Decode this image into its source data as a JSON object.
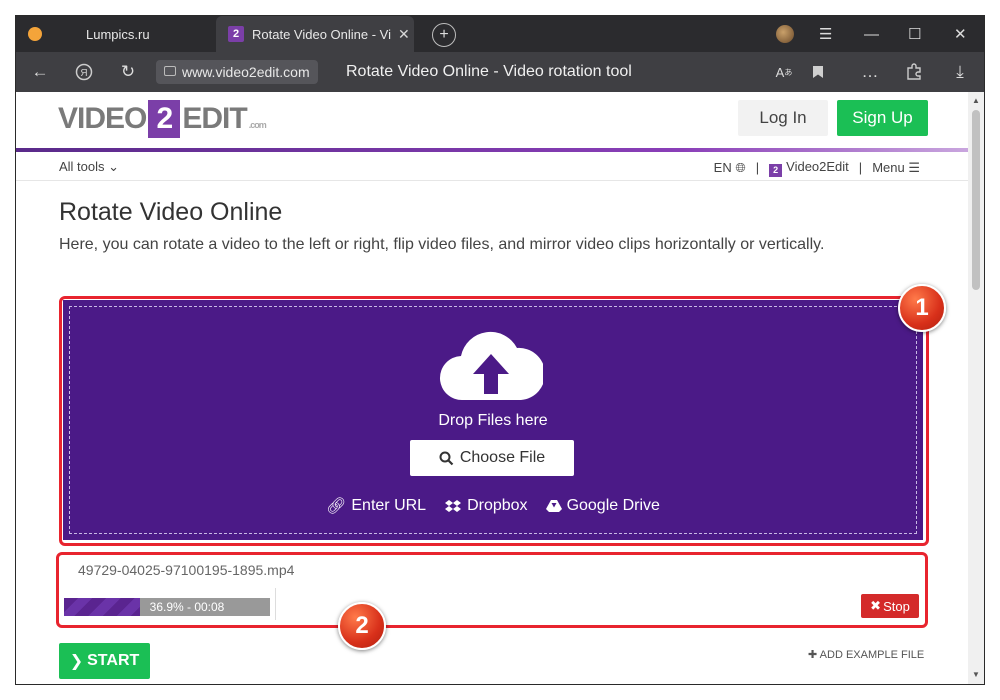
{
  "browser": {
    "tabs": [
      {
        "label": "Lumpics.ru"
      },
      {
        "label": "Rotate Video Online - Vi",
        "favicon_text": "2"
      }
    ],
    "url": "www.video2edit.com",
    "page_title": "Rotate Video Online - Video rotation tool"
  },
  "site": {
    "logo_video": "VIDEO",
    "logo_two": "2",
    "logo_edit": "EDIT",
    "logo_com": ".com",
    "login_label": "Log In",
    "signup_label": "Sign Up",
    "all_tools": "All tools",
    "lang": "EN",
    "brand_link": "Video2Edit",
    "brand_badge": "2",
    "menu": "Menu"
  },
  "main": {
    "title": "Rotate Video Online",
    "description": "Here, you can rotate a video to the left or right, flip video files, and mirror video clips horizontally or vertically."
  },
  "upload": {
    "drop_text": "Drop Files here",
    "choose_label": "Choose File",
    "enter_url": "Enter URL",
    "dropbox": "Dropbox",
    "google_drive": "Google Drive"
  },
  "file": {
    "name": "49729-04025-97100195-1895.mp4",
    "progress_text": "36.9% - 00:08",
    "progress_percent": 36.9,
    "stop_label": "Stop"
  },
  "actions": {
    "start_label": "START",
    "add_example": "ADD EXAMPLE FILE"
  },
  "callouts": [
    "1",
    "2"
  ],
  "colors": {
    "accent_purple": "#4b1a87",
    "brand_purple": "#7b3fa8",
    "green": "#1bbf55",
    "highlight_red": "#e8242e",
    "stop_red": "#d42a2a"
  }
}
